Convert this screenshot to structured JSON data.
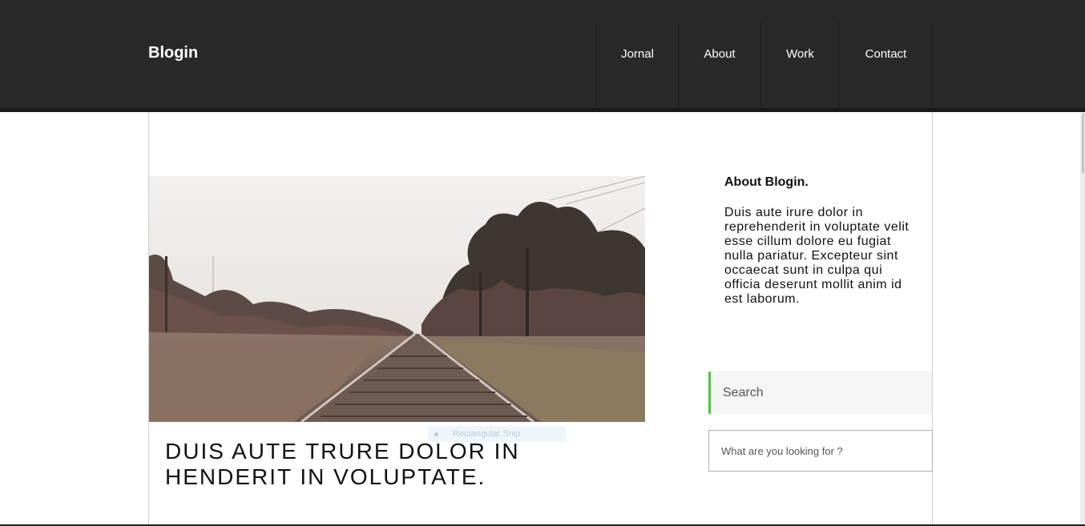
{
  "header": {
    "brand": "Blogin",
    "nav": [
      "Jornal",
      "About",
      "Work",
      "Contact"
    ]
  },
  "hero": {
    "image_icon": "railroad-photo",
    "overlay_label": "Rectangular Snip"
  },
  "post": {
    "title_line1": "DUIS AUTE TRURE DOLOR IN",
    "title_line2": "HENDERIT IN VOLUPTATE."
  },
  "sidebar": {
    "about_heading": "About Blogin.",
    "about_text": "Duis aute irure dolor in reprehenderit in voluptate velit esse cillum dolore eu fugiat nulla pariatur. Excepteur sint occaecat sunt in culpa qui officia deserunt mollit anim id est laborum.",
    "search_heading": "Search",
    "search_placeholder": "What are you looking for ?"
  },
  "colors": {
    "header_bg": "#292929",
    "accent": "#55c142"
  }
}
